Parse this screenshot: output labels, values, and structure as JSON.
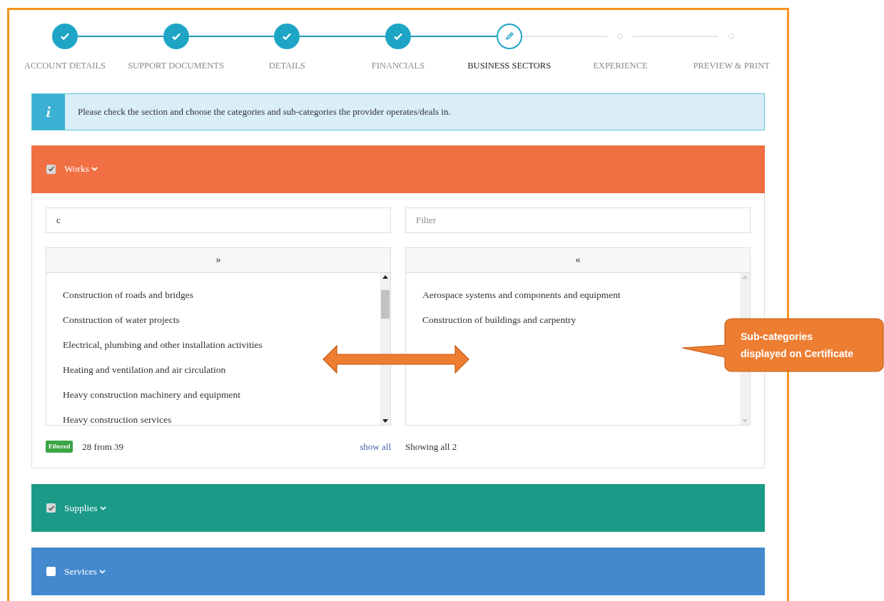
{
  "steps": [
    {
      "label": "ACCOUNT DETAILS",
      "kind": "done"
    },
    {
      "label": "SUPPORT DOCUMENTS",
      "kind": "done"
    },
    {
      "label": "DETAILS",
      "kind": "done"
    },
    {
      "label": "FINANCIALS",
      "kind": "done"
    },
    {
      "label": "BUSINESS SECTORS",
      "kind": "current"
    },
    {
      "label": "EXPERIENCE",
      "kind": "pending"
    },
    {
      "label": "PREVIEW & PRINT",
      "kind": "pending"
    }
  ],
  "info": {
    "text": "Please check the section and choose the categories and sub-categories the provider operates/deals in."
  },
  "sections": [
    {
      "title": "Works",
      "checked": true,
      "expanded": true,
      "color": "#f07044",
      "available": {
        "search_value": "c",
        "move_label": "»",
        "items": [
          "Construction of roads and bridges",
          "Construction of water projects",
          "Electrical, plumbing and other installation activities",
          "Heating and ventilation and air circulation",
          "Heavy construction machinery and equipment",
          "Heavy construction services"
        ],
        "badge": "Filtered",
        "count": "28 from 39",
        "show_all": "show all"
      },
      "selected": {
        "placeholder": "Filter",
        "move_label": "«",
        "items": [
          "Aerospace systems and components and equipment",
          "Construction of buildings and carpentry"
        ],
        "count": "Showing all 2"
      }
    },
    {
      "title": "Supplies",
      "checked": true,
      "expanded": false,
      "color": "#1a9a87"
    },
    {
      "title": "Services",
      "checked": false,
      "expanded": false,
      "color": "#4489cd"
    }
  ],
  "annotation": {
    "text": "Sub-categories displayed on Certificate"
  }
}
